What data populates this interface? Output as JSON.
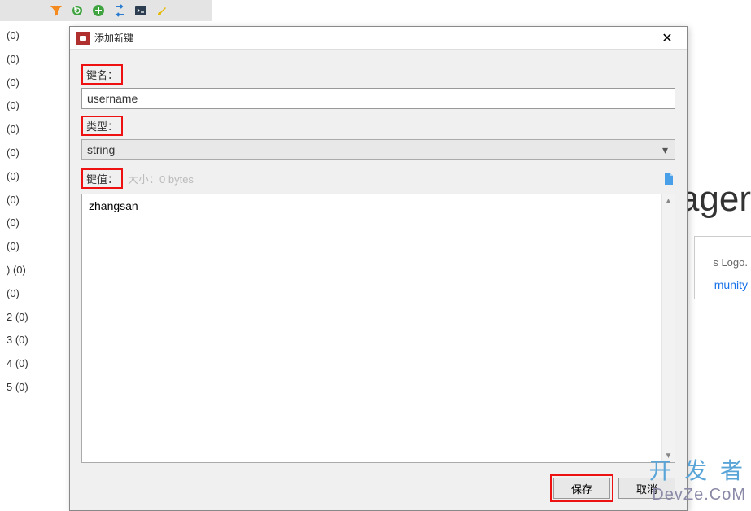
{
  "sidebar": {
    "items": [
      {
        "label": "(0)"
      },
      {
        "label": "(0)"
      },
      {
        "label": "(0)"
      },
      {
        "label": "(0)"
      },
      {
        "label": "(0)"
      },
      {
        "label": "(0)"
      },
      {
        "label": "(0)"
      },
      {
        "label": "(0)"
      },
      {
        "label": "(0)"
      },
      {
        "label": "(0)"
      },
      {
        "label": ")  (0)"
      },
      {
        "label": "  (0)"
      },
      {
        "label": "2  (0)"
      },
      {
        "label": "3  (0)"
      },
      {
        "label": "4  (0)"
      },
      {
        "label": "5  (0)"
      }
    ]
  },
  "background": {
    "title_fragment": "ager",
    "sub1": "s Logo.",
    "sub2": "munity"
  },
  "dialog": {
    "title": "添加新键",
    "key_label": "键名：",
    "key_value": "username",
    "type_label": "类型：",
    "type_value": "string",
    "value_label": "键值：",
    "value_hint": "大小：0 bytes",
    "value_text": "zhangsan",
    "save_label": "保存",
    "cancel_label": "取消"
  },
  "watermark": {
    "line1": "开 发 者",
    "line2": "DevZe.CoM"
  }
}
